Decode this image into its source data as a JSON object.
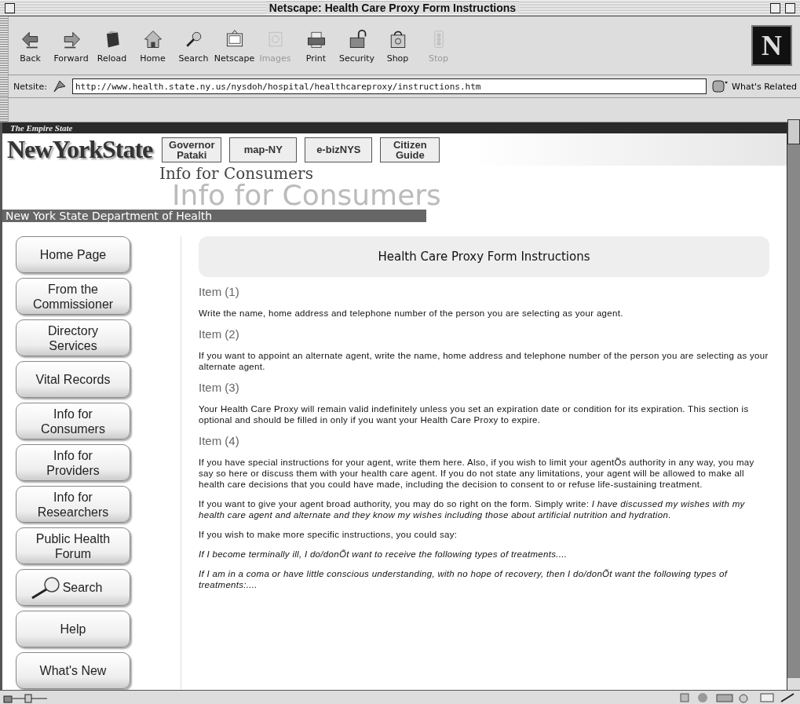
{
  "window": {
    "title": "Netscape: Health Care Proxy Form Instructions"
  },
  "toolbar": [
    {
      "label": "Back",
      "disabled": false
    },
    {
      "label": "Forward",
      "disabled": false
    },
    {
      "label": "Reload",
      "disabled": false
    },
    {
      "label": "Home",
      "disabled": false
    },
    {
      "label": "Search",
      "disabled": false
    },
    {
      "label": "Netscape",
      "disabled": false
    },
    {
      "label": "Images",
      "disabled": true
    },
    {
      "label": "Print",
      "disabled": false
    },
    {
      "label": "Security",
      "disabled": false
    },
    {
      "label": "Shop",
      "disabled": false
    },
    {
      "label": "Stop",
      "disabled": true
    }
  ],
  "logo": "N",
  "location": {
    "label": "Netsite:",
    "url": "http://www.health.state.ny.us/nysdoh/hospital/healthcareproxy/instructions.htm",
    "related": "What's Related"
  },
  "page": {
    "tagline": "The Empire State",
    "brand": "NewYorkState",
    "top_links": [
      "Governor Pataki",
      "map-NY",
      "e-bizNYS",
      "Citizen Guide"
    ],
    "section_title": "Info for Consumers",
    "section_title_shadow": "Info for Consumers",
    "department": "New York State Department of Health",
    "nav": [
      {
        "label": "Home Page",
        "kind": "plain"
      },
      {
        "label": "From the Commissioner",
        "kind": "plain"
      },
      {
        "label": "Directory Services",
        "kind": "plain"
      },
      {
        "label": "Vital Records",
        "kind": "plain"
      },
      {
        "label": "Info for Consumers",
        "kind": "plain"
      },
      {
        "label": "Info for Providers",
        "kind": "plain"
      },
      {
        "label": "Info for Researchers",
        "kind": "plain"
      },
      {
        "label": "Public Health Forum",
        "kind": "plain"
      },
      {
        "label": "Search",
        "kind": "search"
      },
      {
        "label": "Help",
        "kind": "plain"
      },
      {
        "label": "What's New",
        "kind": "plain"
      }
    ],
    "heading": "Health Care Proxy Form Instructions",
    "items": [
      {
        "title": "Item (1)",
        "paragraphs": [
          {
            "text": "Write the name, home address and telephone number of the person you are selecting as your agent.",
            "italic": false
          }
        ]
      },
      {
        "title": "Item (2)",
        "paragraphs": [
          {
            "text": "If you want to appoint an alternate agent, write the name, home address and telephone number of the person you are selecting as your alternate agent.",
            "italic": false
          }
        ]
      },
      {
        "title": "Item (3)",
        "paragraphs": [
          {
            "text": "Your Health Care Proxy will remain valid indefinitely unless you set an expiration date or condition for its expiration. This section is optional and should be filled in only if you want your Health Care Proxy to expire.",
            "italic": false
          }
        ]
      },
      {
        "title": "Item (4)",
        "paragraphs": [
          {
            "text": "If you have special instructions for your agent, write them here. Also, if you wish to limit your agentÕs authority in any way, you may say so here or discuss them with your health care agent. If you do not state any limitations, your agent will be allowed to make all health care decisions that you could have made, including the decision to consent to or refuse life-sustaining treatment.",
            "italic": false
          },
          {
            "text": "If you want to give your agent broad authority, you may do so right on the form. Simply write: *I have discussed my wishes with my health care agent and alternate and they know my wishes including those about artificial nutrition and hydration*.",
            "italic": false
          },
          {
            "text": "If you wish to make more specific instructions, you could say:",
            "italic": false
          },
          {
            "text": "If I become terminally ill, I do/donÕt want to receive the following types of treatments....",
            "italic": true
          },
          {
            "text": "If I am in a coma or have little conscious understanding, with no hope of recovery, then I do/donÕt want the following types of treatments:....",
            "italic": true
          }
        ]
      }
    ]
  }
}
